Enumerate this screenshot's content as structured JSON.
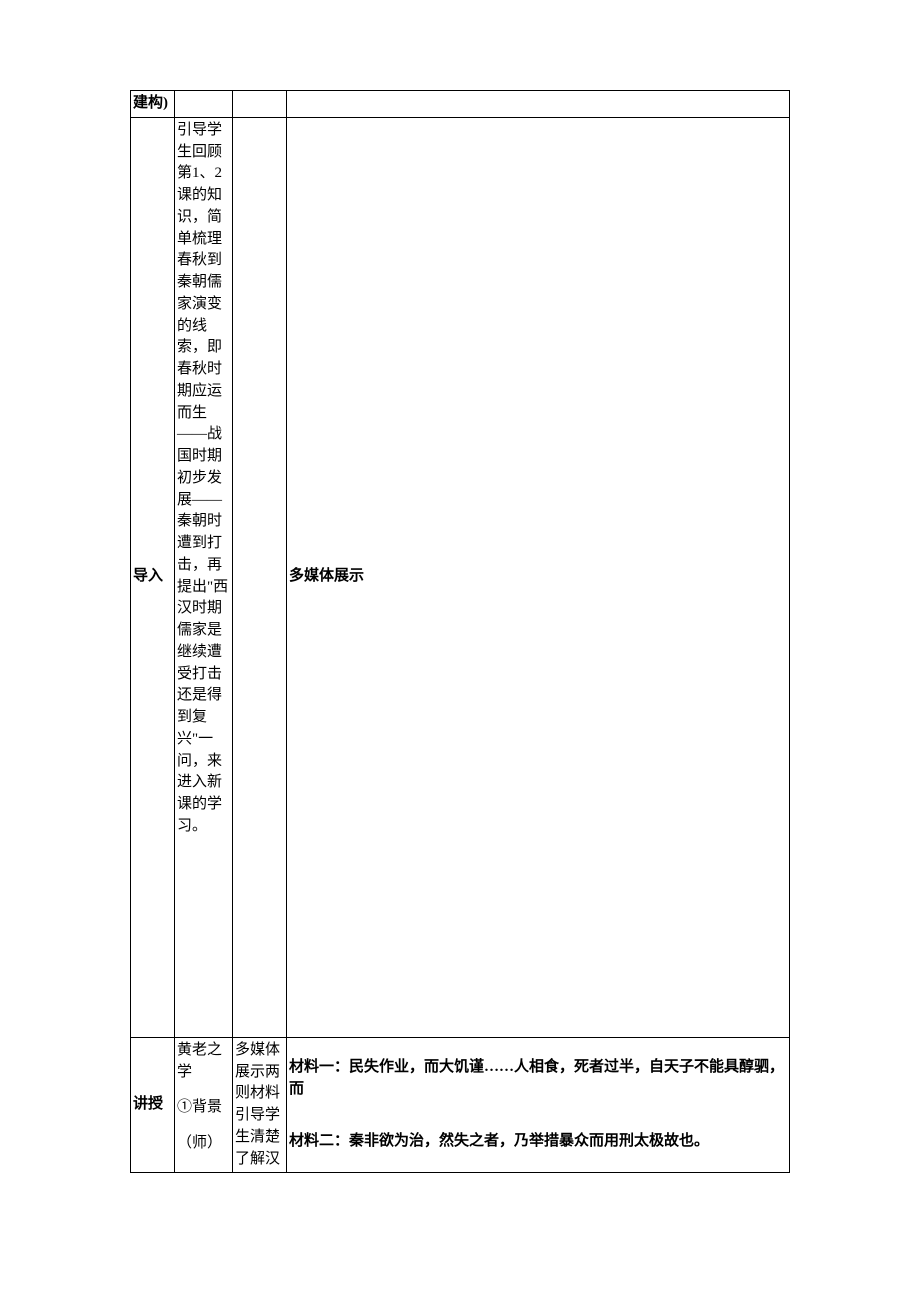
{
  "rows": {
    "r0": {
      "c1": "建构)"
    },
    "r1": {
      "c1": "导入",
      "c2": "引导学生回顾第1、2课的知识，简单梳理春秋到秦朝儒家演变的线索，即春秋时期应运而生——战国时期初步发展——秦朝时遭到打击，再提出\"西汉时期儒家是继续遭受打击还是得到复兴\"一问，来进入新课的学习。",
      "c4": "多媒体展示"
    },
    "r2": {
      "c1": "讲授",
      "c2_line1": "黄老之学",
      "c2_line2": "①背景",
      "c2_line3": "（师）",
      "c3": "多媒体展示两则材料引导学生清楚了解汉",
      "c4_p1": "材料一：民失作业，而大饥谨……人相食，死者过半，自天子不能具醇驷，而",
      "c4_p2": "材料二：秦非欲为治，然失之者，乃举措暴众而用刑太极故也。"
    }
  }
}
